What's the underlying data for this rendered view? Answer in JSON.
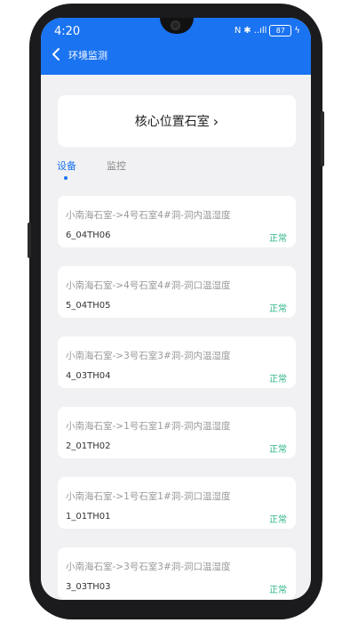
{
  "status_bar": {
    "time": "4:20",
    "signal_text": "..ıll",
    "battery": "87"
  },
  "header": {
    "back_icon": "chevron-left-icon",
    "title": "环境监测"
  },
  "location": {
    "label": "核心位置石室",
    "chevron": "›"
  },
  "tabs": [
    {
      "label": "设备",
      "active": true
    },
    {
      "label": "监控",
      "active": false
    }
  ],
  "devices": [
    {
      "name": "小南海石室->4号石室4#洞-洞内温湿度",
      "code": "6_04TH06",
      "status": "正常"
    },
    {
      "name": "小南海石室->4号石室4#洞-洞口温湿度",
      "code": "5_04TH05",
      "status": "正常"
    },
    {
      "name": "小南海石室->3号石室3#洞-洞内温湿度",
      "code": "4_03TH04",
      "status": "正常"
    },
    {
      "name": "小南海石室->1号石室1#洞-洞内温湿度",
      "code": "2_01TH02",
      "status": "正常"
    },
    {
      "name": "小南海石室->1号石室1#洞-洞口温湿度",
      "code": "1_01TH01",
      "status": "正常"
    },
    {
      "name": "小南海石室->3号石室3#洞-洞口温湿度",
      "code": "3_03TH03",
      "status": "正常"
    }
  ],
  "colors": {
    "accent": "#1a73f0",
    "status_ok": "#2fb58a",
    "background": "#f1f1f3"
  }
}
